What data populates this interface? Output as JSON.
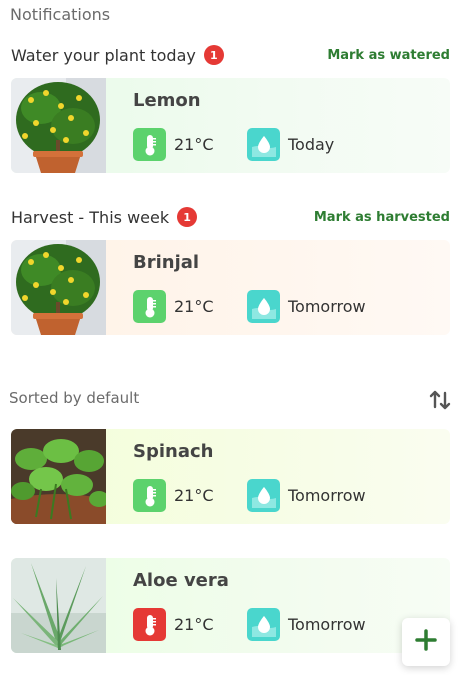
{
  "header": {
    "title": "Notifications"
  },
  "water_group": {
    "title": "Water your plant today",
    "badge": "1",
    "action": "Mark as watered",
    "card": {
      "name": "Lemon",
      "temperature": "21°C",
      "water": "Today",
      "temp_status": "green"
    }
  },
  "harvest_group": {
    "title": "Harvest - This week",
    "badge": "1",
    "action": "Mark as harvested",
    "card": {
      "name": "Brinjal",
      "temperature": "21°C",
      "water": "Tomorrow",
      "temp_status": "green"
    }
  },
  "sort": {
    "label": "Sorted by default",
    "icon": "sort-arrows-icon"
  },
  "plants": [
    {
      "name": "Spinach",
      "temperature": "21°C",
      "water": "Tomorrow",
      "temp_status": "green"
    },
    {
      "name": "Aloe vera",
      "temperature": "21°C",
      "water": "Tomorrow",
      "temp_status": "red"
    }
  ],
  "fab": {
    "icon": "plus-icon"
  },
  "colors": {
    "accent": "#2e7d32",
    "badge": "#e53935",
    "temp_ok": "#5cd26d",
    "temp_alert": "#e53935",
    "water": "#4ad6cd"
  }
}
